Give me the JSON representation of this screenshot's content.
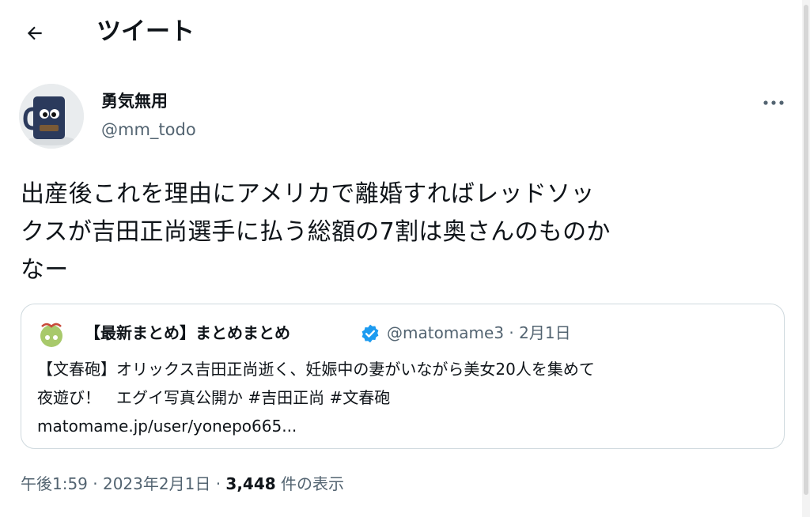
{
  "header": {
    "title": "ツイート"
  },
  "tweet": {
    "author_name": "勇気無用",
    "author_handle": "@mm_todo",
    "text_lines": [
      "出産後これを理由にアメリカで離婚すればレッドソッ",
      "クスが吉田正尚選手に払う総額の7割は奥さんのものか",
      "なー"
    ],
    "quoted": {
      "name": "【最新まとめ】まとめまとめ",
      "handle_date": "@matomame3 · 2月1日",
      "text_lines": [
        "【文春砲】オリックス吉田正尚逝く、妊娠中の妻がいながら美女20人を集めて",
        "夜遊び！　エグイ写真公開か #吉田正尚 #文春砲",
        "matomame.jp/user/yonepo665..."
      ]
    },
    "meta": {
      "time_date": "午後1:59 · 2023年2月1日 · ",
      "views_count": "3,448",
      "views_label": " 件の表示"
    }
  },
  "colors": {
    "accent": "#1d9bf0",
    "text": "#0f1419",
    "secondary": "#536471",
    "border": "#cfd9de"
  },
  "icons": {
    "back": "arrow-left-icon",
    "more": "more-dots-icon",
    "verified": "verified-badge-icon"
  }
}
